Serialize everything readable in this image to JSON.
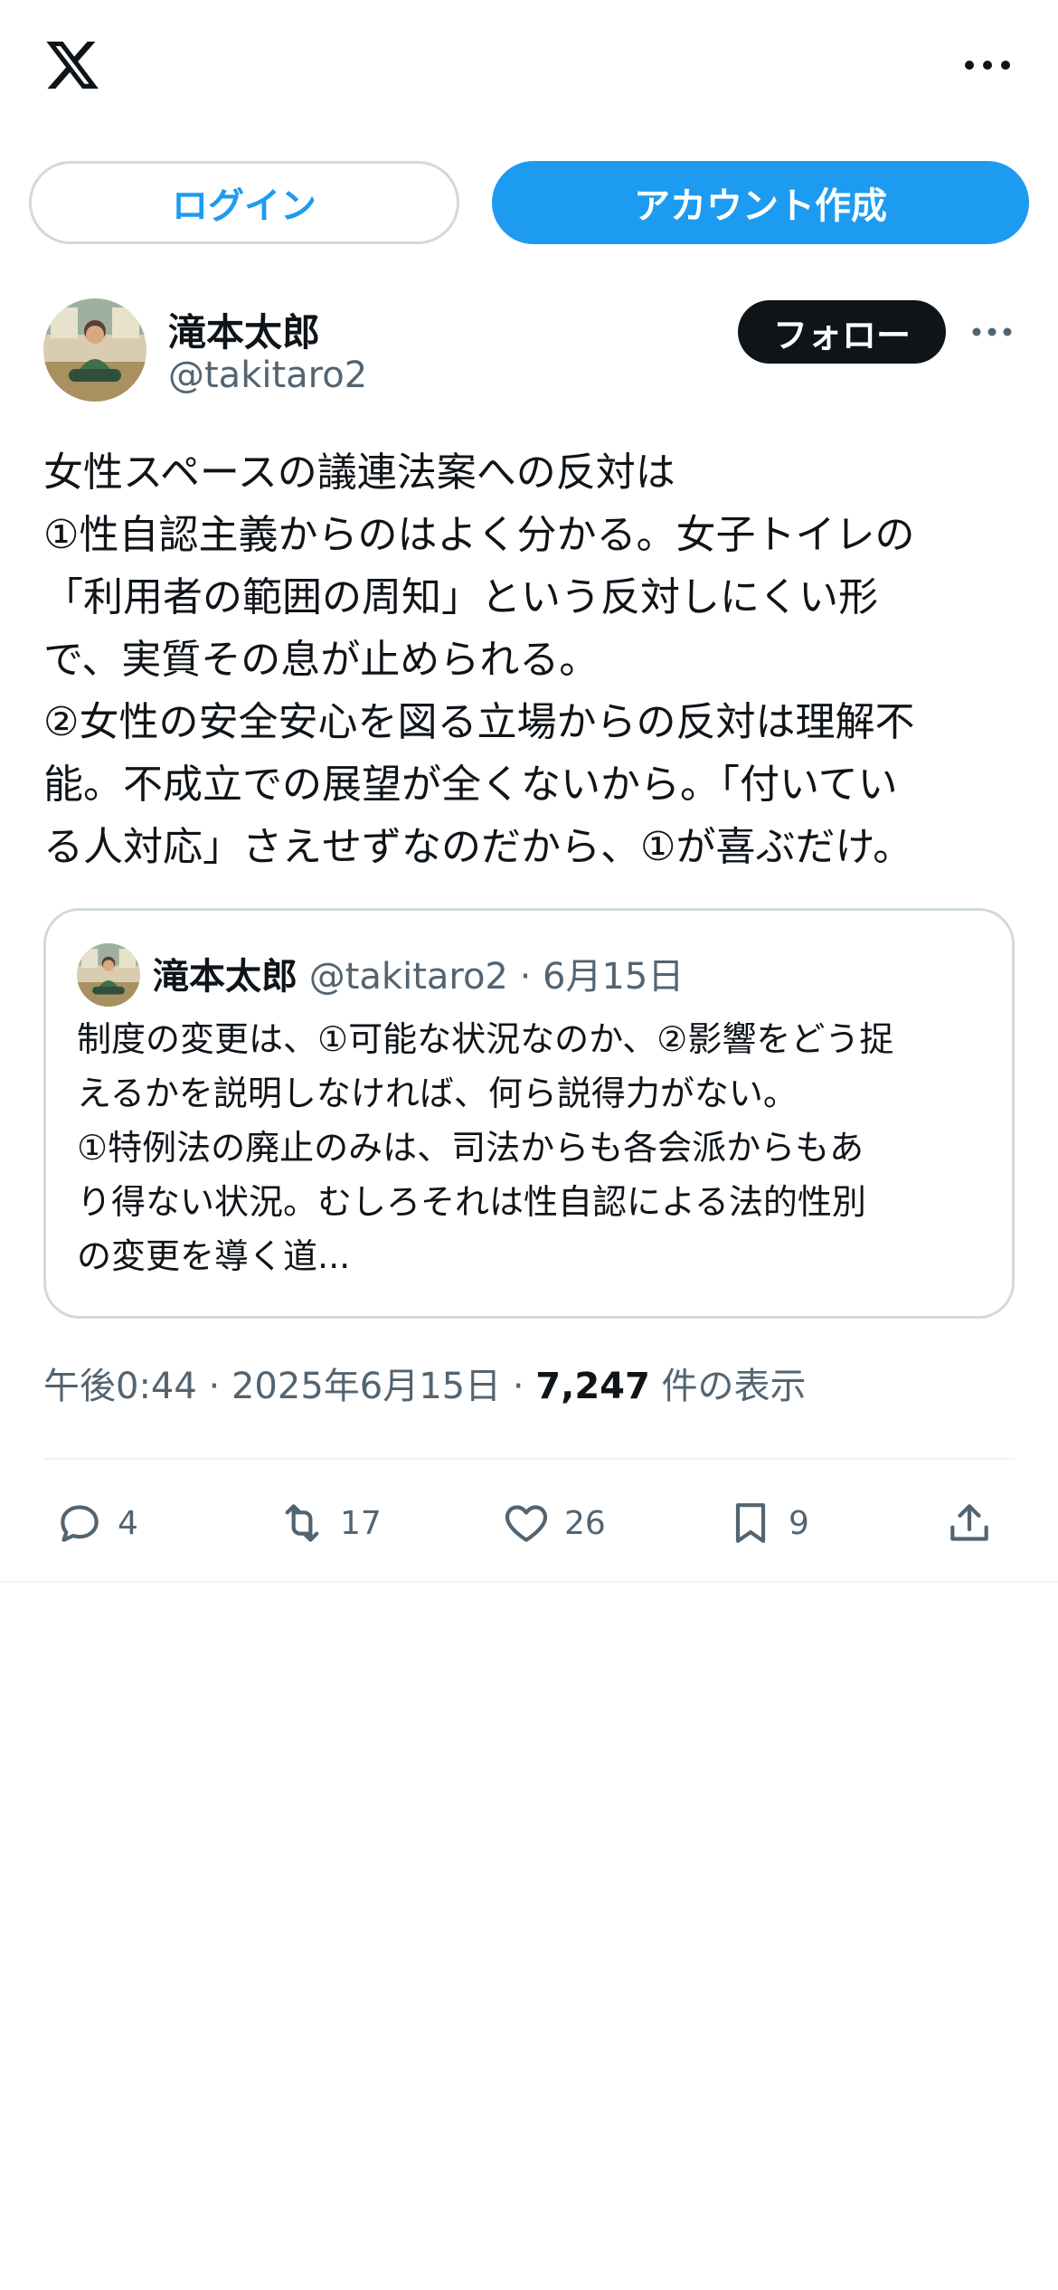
{
  "header": {
    "logo_icon": "x-logo-icon",
    "more_icon": "more-horizontal-icon"
  },
  "auth": {
    "login_label": "ログイン",
    "signup_label": "アカウント作成"
  },
  "author": {
    "name": "滝本太郎",
    "handle": "@takitaro2",
    "follow_label": "フォロー"
  },
  "tweet": {
    "lines": [
      "女性スペースの議連法案への反対は",
      "①性自認主義からのはよく分かる。女子トイレの",
      "「利用者の範囲の周知」という反対しにくい形",
      "で、実質その息が止められる。",
      "②女性の安全安心を図る立場からの反対は理解不",
      "能。不成立での展望が全くないから。「付いてい",
      "る人対応」さえせずなのだから、①が喜ぶだけ。"
    ]
  },
  "quote": {
    "name": "滝本太郎",
    "handle": "@takitaro2",
    "separator": "·",
    "date": "6月15日",
    "lines": [
      "制度の変更は、①可能な状況なのか、②影響をどう捉",
      "えるかを説明しなければ、何ら説得力がない。",
      "①特例法の廃止のみは、司法からも各会派からもあ",
      "り得ない状況。むしろそれは性自認による法的性別",
      "の変更を導く道..."
    ]
  },
  "meta": {
    "time": "午後0:44",
    "sep1": "·",
    "date": "2025年6月15日",
    "sep2": "·",
    "views": "7,247",
    "views_label": "件の表示"
  },
  "actions": {
    "reply_count": "4",
    "retweet_count": "17",
    "like_count": "26",
    "bookmark_count": "9"
  },
  "colors": {
    "accent": "#1d9bf0",
    "text": "#0f1419",
    "secondary": "#536471",
    "border": "#cfd9de"
  }
}
